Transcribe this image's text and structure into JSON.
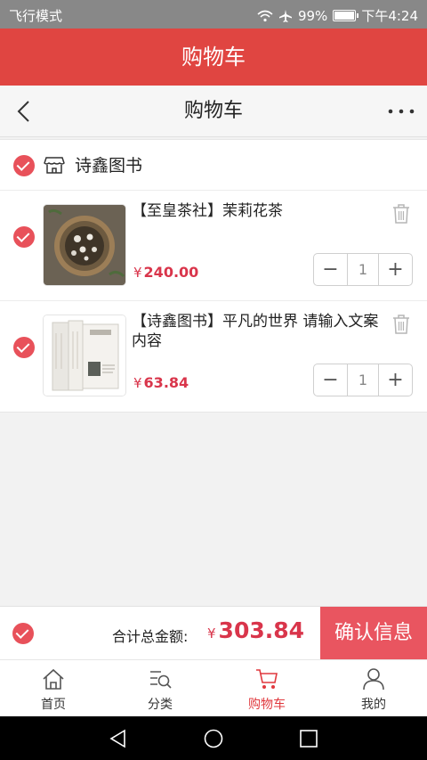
{
  "status_bar": {
    "carrier": "飞行模式",
    "battery": "99%",
    "time": "下午4:24"
  },
  "app_header": {
    "title": "购物车"
  },
  "nav": {
    "title": "购物车",
    "back_icon": "chevron-left-icon",
    "more_icon": "more-horizontal-icon"
  },
  "shop": {
    "name": "诗鑫图书",
    "icon": "store-icon"
  },
  "items": [
    {
      "name": "【至皇茶社】茉莉花茶",
      "currency": "¥",
      "price": "240.00",
      "quantity": "1",
      "minus": "−",
      "plus": "+"
    },
    {
      "name": "【诗鑫图书】平凡的世界 请输入文案内容",
      "currency": "¥",
      "price": "63.84",
      "quantity": "1",
      "minus": "−",
      "plus": "+"
    }
  ],
  "total": {
    "label": "合计总金额:",
    "currency": "¥",
    "amount": "303.84",
    "confirm_label": "确认信息"
  },
  "tabs": [
    {
      "label": "首页",
      "icon": "home-icon",
      "active": false
    },
    {
      "label": "分类",
      "icon": "category-search-icon",
      "active": false
    },
    {
      "label": "购物车",
      "icon": "cart-icon",
      "active": true
    },
    {
      "label": "我的",
      "icon": "user-icon",
      "active": false
    }
  ],
  "colors": {
    "header_red": "#e04541",
    "accent_red": "#e0393e",
    "check_pink": "#e8515a",
    "price_red": "#d9354b",
    "confirm_bg": "#e95560"
  }
}
